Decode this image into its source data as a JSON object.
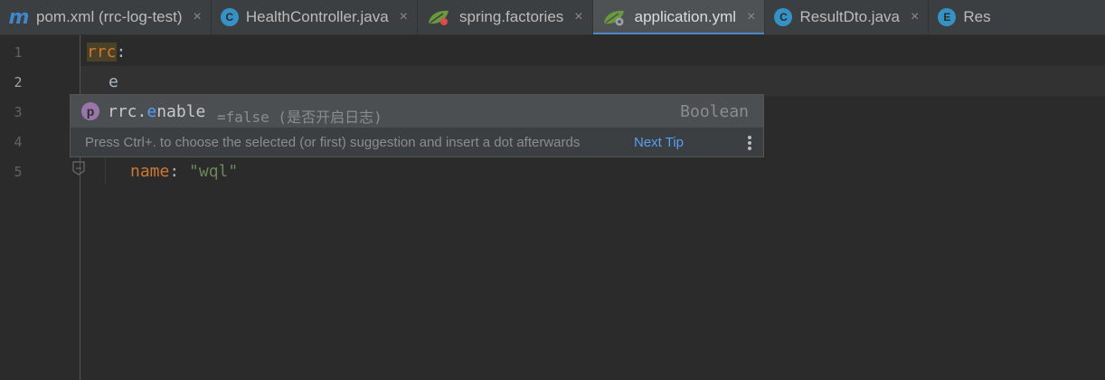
{
  "tabs": [
    {
      "label": "pom.xml (rrc-log-test)",
      "icon": "maven-icon",
      "icon_glyph": "m",
      "active": false
    },
    {
      "label": "HealthController.java",
      "icon": "java-class-icon",
      "icon_glyph": "C",
      "active": false
    },
    {
      "label": "spring.factories",
      "icon": "spring-leaf-icon",
      "active": false
    },
    {
      "label": "application.yml",
      "icon": "spring-config-icon",
      "active": true
    },
    {
      "label": "ResultDto.java",
      "icon": "java-class-icon",
      "icon_glyph": "C",
      "active": false
    },
    {
      "label": "Res",
      "icon": "java-enum-icon",
      "icon_glyph": "E",
      "active": false
    }
  ],
  "close_glyph": "×",
  "gutter": {
    "line_numbers": [
      "1",
      "2",
      "3",
      "4",
      "5"
    ],
    "current_line": 2
  },
  "editor": {
    "line1": {
      "key": "rrc",
      "colon": ":"
    },
    "line2": {
      "typed": "e"
    },
    "line5": {
      "key": "name",
      "colon": ": ",
      "value": "\"wql\""
    }
  },
  "completion": {
    "icon_glyph": "p",
    "prefix": "rrc.",
    "match": "e",
    "rest": "nable",
    "tail": "=false (是否开启日志)",
    "type": "Boolean",
    "hint": "Press Ctrl+. to choose the selected (or first) suggestion and insert a dot afterwards",
    "next_tip": "Next Tip"
  },
  "colors": {
    "accent": "#4a88c7",
    "keyword": "#cc7832",
    "string": "#6a8759",
    "match": "#589df6",
    "property_icon": "#9876aa"
  }
}
